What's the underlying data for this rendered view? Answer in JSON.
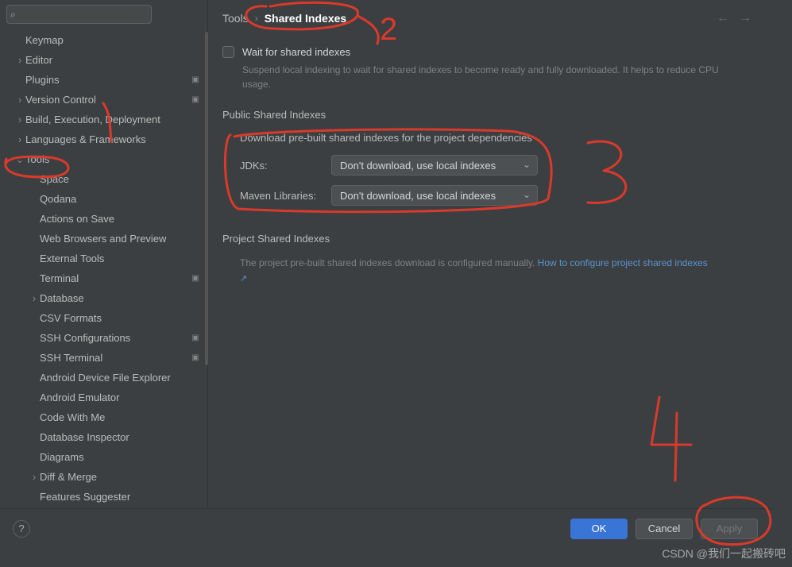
{
  "search": {
    "placeholder": ""
  },
  "sidebar": {
    "items": [
      {
        "label": "Keymap",
        "indent": 32,
        "arrow": null,
        "proj": false
      },
      {
        "label": "Editor",
        "indent": 18,
        "arrow": "closed",
        "proj": false
      },
      {
        "label": "Plugins",
        "indent": 32,
        "arrow": null,
        "proj": true
      },
      {
        "label": "Version Control",
        "indent": 18,
        "arrow": "closed",
        "proj": true
      },
      {
        "label": "Build, Execution, Deployment",
        "indent": 18,
        "arrow": "closed",
        "proj": false
      },
      {
        "label": "Languages & Frameworks",
        "indent": 18,
        "arrow": "closed",
        "proj": false
      },
      {
        "label": "Tools",
        "indent": 18,
        "arrow": "open",
        "proj": false,
        "selected": false
      },
      {
        "label": "Space",
        "indent": 50,
        "arrow": null,
        "proj": false
      },
      {
        "label": "Qodana",
        "indent": 50,
        "arrow": null,
        "proj": false
      },
      {
        "label": "Actions on Save",
        "indent": 50,
        "arrow": null,
        "proj": false
      },
      {
        "label": "Web Browsers and Preview",
        "indent": 50,
        "arrow": null,
        "proj": false
      },
      {
        "label": "External Tools",
        "indent": 50,
        "arrow": null,
        "proj": false
      },
      {
        "label": "Terminal",
        "indent": 50,
        "arrow": null,
        "proj": true
      },
      {
        "label": "Database",
        "indent": 36,
        "arrow": "closed",
        "proj": false
      },
      {
        "label": "CSV Formats",
        "indent": 50,
        "arrow": null,
        "proj": false
      },
      {
        "label": "SSH Configurations",
        "indent": 50,
        "arrow": null,
        "proj": true
      },
      {
        "label": "SSH Terminal",
        "indent": 50,
        "arrow": null,
        "proj": true
      },
      {
        "label": "Android Device File Explorer",
        "indent": 50,
        "arrow": null,
        "proj": false
      },
      {
        "label": "Android Emulator",
        "indent": 50,
        "arrow": null,
        "proj": false
      },
      {
        "label": "Code With Me",
        "indent": 50,
        "arrow": null,
        "proj": false
      },
      {
        "label": "Database Inspector",
        "indent": 50,
        "arrow": null,
        "proj": false
      },
      {
        "label": "Diagrams",
        "indent": 50,
        "arrow": null,
        "proj": false
      },
      {
        "label": "Diff & Merge",
        "indent": 36,
        "arrow": "closed",
        "proj": false
      },
      {
        "label": "Features Suggester",
        "indent": 50,
        "arrow": null,
        "proj": false
      }
    ]
  },
  "breadcrumb": {
    "parent": "Tools",
    "current": "Shared Indexes"
  },
  "wait_checkbox": {
    "label": "Wait for shared indexes",
    "help": "Suspend local indexing to wait for shared indexes to become ready and fully downloaded. It helps to reduce CPU usage."
  },
  "public_group": {
    "title": "Public Shared Indexes",
    "desc": "Download pre-built shared indexes for the project dependencies",
    "jdk_label": "JDKs:",
    "jdk_value": "Don't download, use local indexes",
    "maven_label": "Maven Libraries:",
    "maven_value": "Don't download, use local indexes"
  },
  "project_group": {
    "title": "Project Shared Indexes",
    "desc": "The project pre-built shared indexes download is configured manually. ",
    "link": "How to configure project shared indexes"
  },
  "footer": {
    "ok": "OK",
    "cancel": "Cancel",
    "apply": "Apply"
  },
  "watermark": "CSDN @我们一起搬砖吧"
}
